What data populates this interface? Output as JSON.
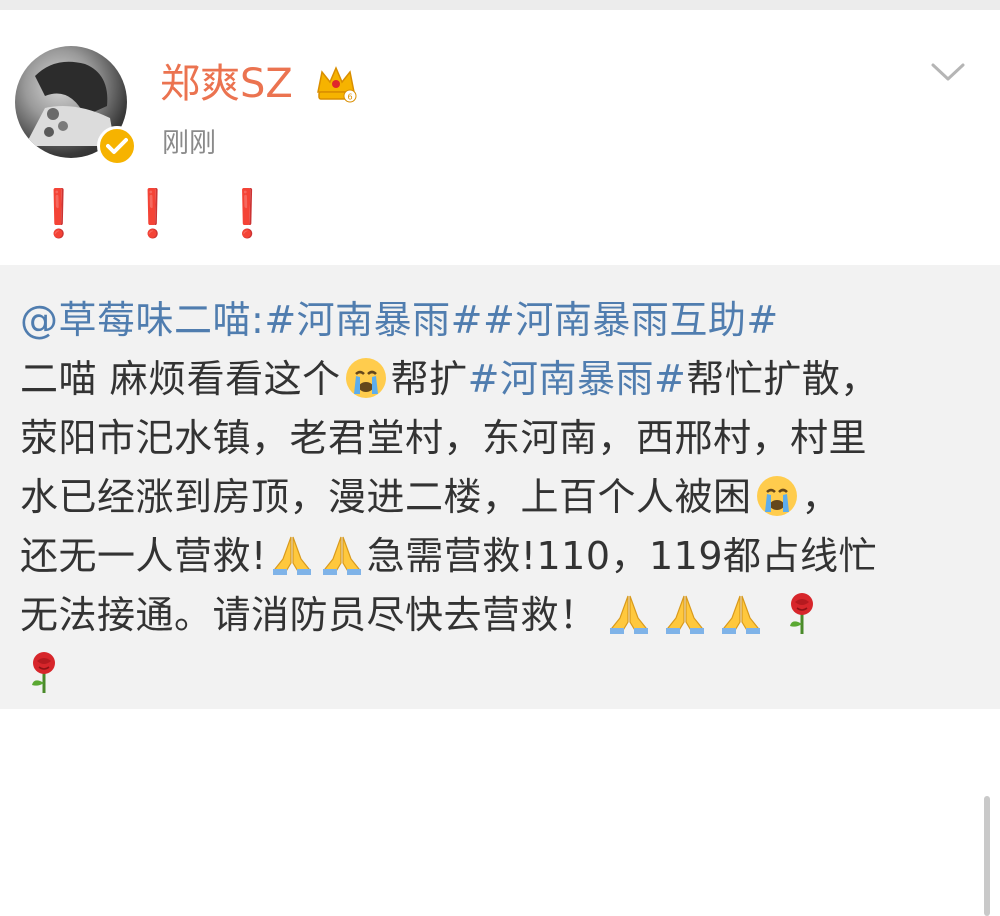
{
  "post": {
    "author": "郑爽SZ",
    "timestamp": "刚刚",
    "body_marks": [
      "❗",
      "❗",
      "❗"
    ],
    "icons": {
      "avatar": "user-avatar",
      "verified": "verified-badge-icon",
      "crown": "vip-crown-icon",
      "menu": "chevron-down-icon"
    }
  },
  "repost": {
    "line1": {
      "mention": "@草莓味二喵",
      "colon": ":",
      "tag1": "#河南暴雨#",
      "tag2": "#河南暴雨互助#"
    },
    "line2": {
      "a": "二喵 麻烦看看这个",
      "b": "帮扩",
      "tag": "#河南暴雨#",
      "c": "帮忙扩散，"
    },
    "line3": "荥阳市汜水镇，老君堂村，东河南，西邢村，村里",
    "line4": {
      "a": "水已经涨到房顶，漫进二楼，上百个人被困",
      "b": "，"
    },
    "line5": {
      "a": "还无一人营救!",
      "b": "急需营救!110，119都占线忙"
    },
    "line6": {
      "a": "无法接通。请消防员尽快去营救！"
    },
    "emojis": [
      "crying-face-icon",
      "folded-hands-icon",
      "rose-icon"
    ]
  },
  "colors": {
    "username": "#eb7350",
    "link": "#507daf",
    "exclaim": "#e0262b",
    "repost_bg": "#f2f2f2"
  }
}
